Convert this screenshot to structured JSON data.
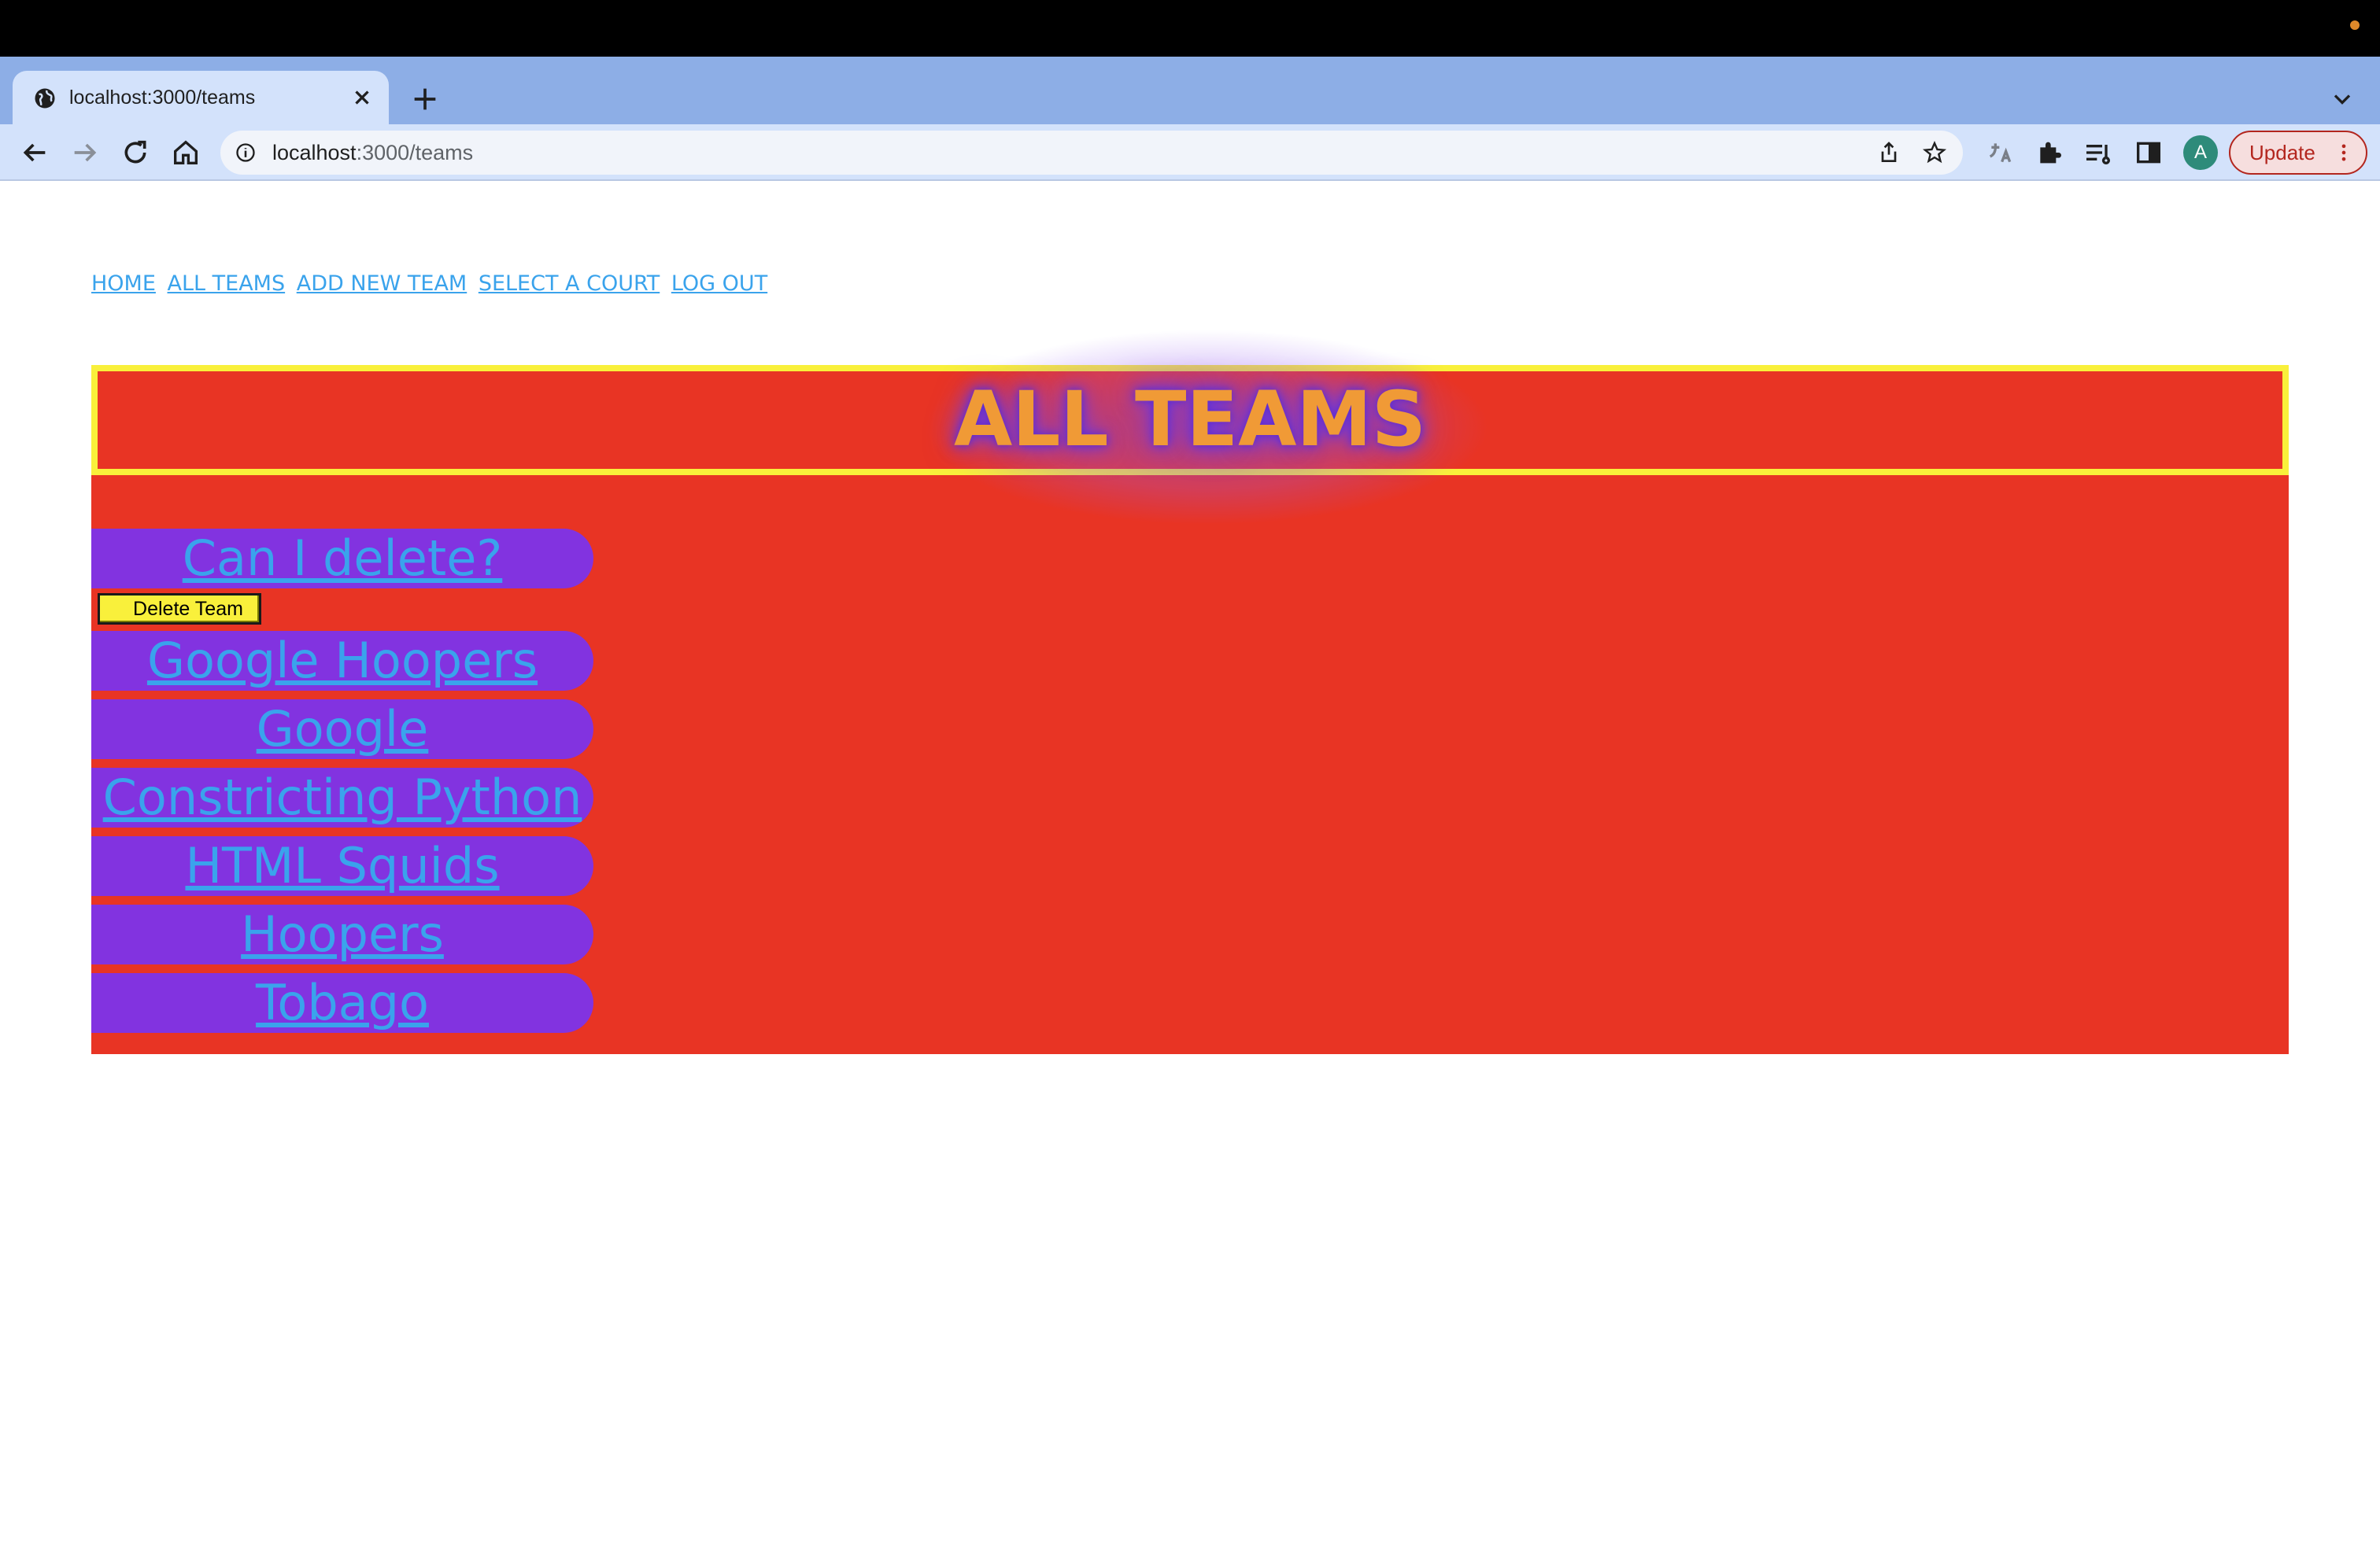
{
  "browser": {
    "tab_title": "localhost:3000/teams",
    "url_host": "localhost",
    "url_rest": ":3000/teams",
    "avatar_letter": "A",
    "update_label": "Update"
  },
  "nav": {
    "links": [
      "HOME",
      "ALL TEAMS",
      "ADD NEW TEAM",
      "SELECT A COURT",
      "LOG OUT"
    ]
  },
  "header": {
    "title": "ALL TEAMS"
  },
  "teams": {
    "items": [
      "Can I delete?",
      "Google Hoopers",
      "Google",
      "Constricting Python",
      "HTML Squids",
      "Hoopers",
      "Tobago"
    ],
    "delete_label": "Delete Team"
  },
  "colors": {
    "panel": "#e83424",
    "header_border": "#f9f03b",
    "title": "#f09a36",
    "pill": "#8233e0",
    "link": "#3aa3ec",
    "button": "#f9f03b"
  }
}
